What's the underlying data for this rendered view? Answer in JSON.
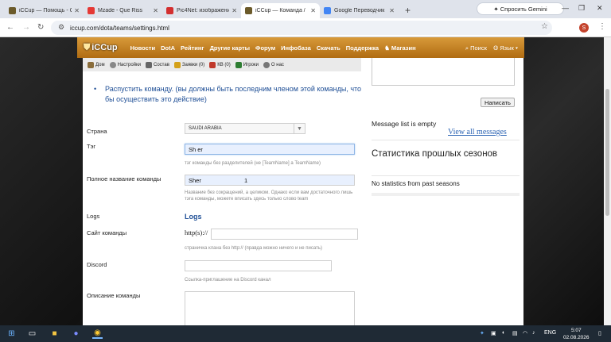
{
  "browser": {
    "tabs": [
      {
        "title": "iCCup — Помощь - С",
        "favicon_color": "#6b5a2a"
      },
      {
        "title": "Mzade - Que Riss",
        "favicon_color": "#e53935"
      },
      {
        "title": "Pic4Net: изображени",
        "favicon_color": "#d32f2f"
      },
      {
        "title": "iCCup — Команда / ",
        "favicon_color": "#6b5a2a"
      },
      {
        "title": "Google Переводчик",
        "favicon_color": "#4285f4"
      }
    ],
    "new_tab": "+",
    "gemini_label": "✦ Спросить Gemini",
    "url": "iccup.com/dota/teams/settings.html",
    "profile_initial": "S"
  },
  "site": {
    "logo": "iCCup",
    "nav": [
      "Новости",
      "DotA",
      "Рейтинг",
      "Другие карты",
      "Форум",
      "Инфобаза",
      "Скачать",
      "Поддержка",
      "Магазин"
    ],
    "search": "Поиск",
    "language": "Язык"
  },
  "subnav": [
    {
      "label": "Дом",
      "color": "#8a6d3b"
    },
    {
      "label": "Настройки",
      "color": "#888888"
    },
    {
      "label": "Состав",
      "color": "#666666"
    },
    {
      "label": "Заявки (0)",
      "color": "#d4a017"
    },
    {
      "label": "КВ (0)",
      "color": "#c0392b"
    },
    {
      "label": "Игроки",
      "color": "#2e7d32"
    },
    {
      "label": "О нас",
      "color": "#777777"
    }
  ],
  "form": {
    "disband_text": "Распустить команду. (вы должны быть последним членом этой команды, что бы осуществить это действие)",
    "country_label": "Страна",
    "country_value": "SAUDI ARABIA",
    "tag_label": "Тэг",
    "tag_value": "Sh er",
    "tag_hint": "тэг команды без разделителей (не [TeamName] а TeamName)",
    "fullname_label": "Полное название команды",
    "fullname_value": "Sher                          1",
    "fullname_hint": "Название без сокращений, а целиком. Однако если вам достаточного лишь тэга команды, можете вписать здесь только слово team",
    "logs_label": "Logs",
    "logs_title": "Logs",
    "site_label": "Сайт команды",
    "site_prefix": "http(s)://",
    "site_hint": "страничка клана без http:// (правда можно ничего и не писать)",
    "discord_label": "Discord",
    "discord_hint": "Ссылка-приглашение на Discord канал",
    "desc_label": "Описание команды"
  },
  "sidebar": {
    "send_button": "Написать",
    "message_status": "Message list is empty",
    "view_all": "View all messages",
    "stats_title": "Статистика прошлых сезонов",
    "stats_none": "No statistics from past seasons"
  },
  "taskbar": {
    "lang": "ENG",
    "time": "5:07",
    "date": "02.08.2026"
  }
}
